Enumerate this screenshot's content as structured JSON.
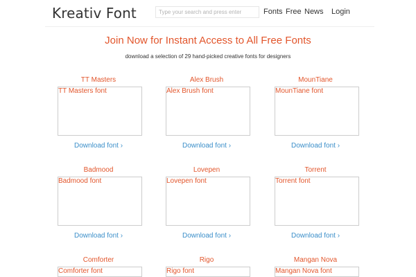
{
  "header": {
    "logo": "Kreativ Font",
    "search_placeholder": "Type your search and press enter",
    "nav": {
      "fonts": "Fonts",
      "free": "Free",
      "news": "News",
      "login": "Login"
    }
  },
  "hero": {
    "title": "Join Now for Instant Access to All Free Fonts",
    "subtitle": "download a selection of 29 hand-picked creative fonts for designers"
  },
  "download_label": "Download font ›",
  "fonts": [
    {
      "name": "TT Masters",
      "preview": "TT Masters font"
    },
    {
      "name": "Alex Brush",
      "preview": "Alex Brush font"
    },
    {
      "name": "MounTiane",
      "preview": "MounTiane font"
    },
    {
      "name": "Badmood",
      "preview": "Badmood font"
    },
    {
      "name": "Lovepen",
      "preview": "Lovepen font"
    },
    {
      "name": "Torrent",
      "preview": "Torrent font"
    },
    {
      "name": "Comforter",
      "preview": "Comforter font"
    },
    {
      "name": "Rigo",
      "preview": "Rigo font"
    },
    {
      "name": "Mangan Nova",
      "preview": "Mangan Nova font"
    }
  ]
}
